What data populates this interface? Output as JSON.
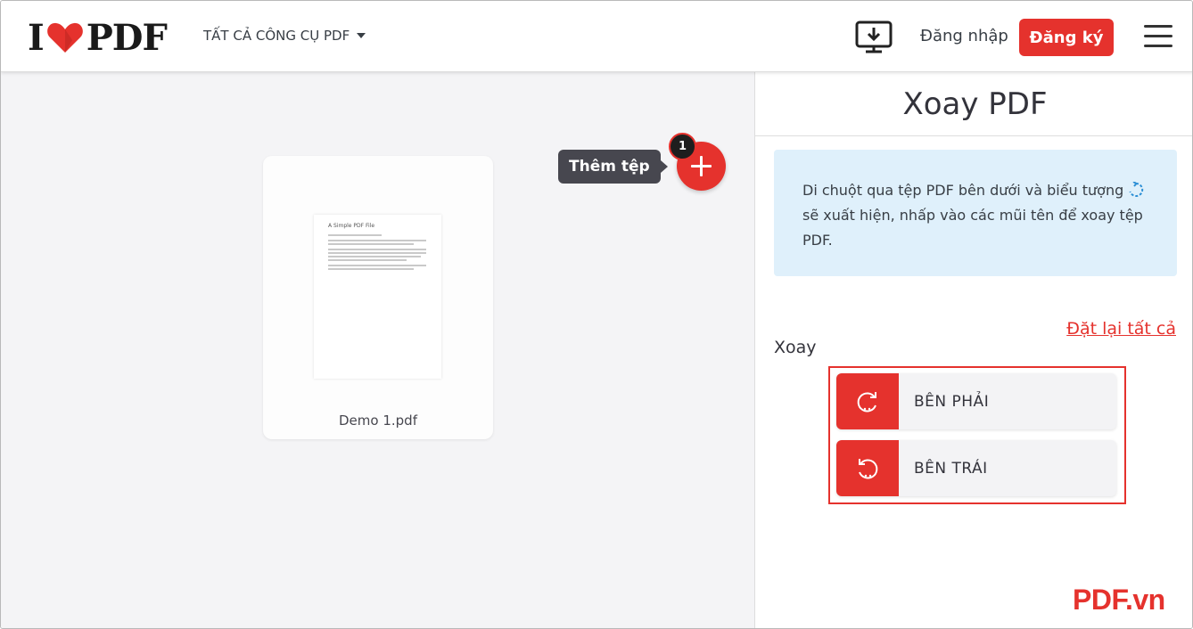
{
  "header": {
    "logo_letter_left": "I",
    "logo_letters_right": "PDF",
    "tools_menu_label": "TẤT CẢ CÔNG CỤ PDF",
    "login_label": "Đăng nhập",
    "signup_label": "Đăng ký"
  },
  "workspace": {
    "file": {
      "name": "Demo 1.pdf",
      "thumbnail_title": "A Simple PDF File"
    },
    "tooltip_label": "Thêm tệp",
    "file_count": "1"
  },
  "sidebar": {
    "title": "Xoay PDF",
    "info_text_before_icon": "Di chuột qua tệp PDF bên dưới và biểu tượng",
    "info_text_after_icon": "sẽ xuất hiện, nhấp vào các mũi tên để xoay tệp PDF.",
    "reset_label": "Đặt lại tất cả",
    "rotate_label": "Xoay",
    "rotate_right_label": "BÊN PHẢI",
    "rotate_left_label": "BÊN TRÁI"
  },
  "watermark": "PDF.vn",
  "colors": {
    "brand_red": "#e5322d",
    "info_bg": "#dff0fb",
    "workspace_bg": "#f4f4f6",
    "tooltip_bg": "#47474f"
  },
  "icons": [
    "heart-icon",
    "caret-down-icon",
    "desktop-download-icon",
    "hamburger-menu-icon",
    "plus-icon",
    "rotate-hint-icon",
    "rotate-right-icon",
    "rotate-left-icon"
  ]
}
